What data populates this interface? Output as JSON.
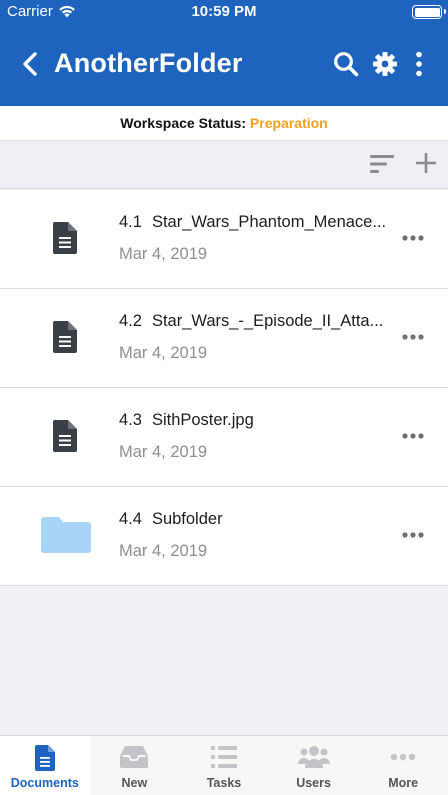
{
  "status_bar": {
    "carrier": "Carrier",
    "time": "10:59 PM"
  },
  "nav": {
    "title": "AnotherFolder",
    "icons": [
      "back-chevron-icon",
      "search-icon",
      "gear-icon",
      "more-vertical-icon"
    ]
  },
  "workspace": {
    "label": "Workspace Status:",
    "value": "Preparation",
    "value_color": "#f0a01e"
  },
  "toolbar": {
    "icons": [
      "sort-icon",
      "add-icon"
    ]
  },
  "items": [
    {
      "number": "4.1",
      "name": "Star_Wars_Phantom_Menace...",
      "date": "Mar 4, 2019",
      "kind": "document"
    },
    {
      "number": "4.2",
      "name": "Star_Wars_-_Episode_II_Atta...",
      "date": "Mar 4, 2019",
      "kind": "document"
    },
    {
      "number": "4.3",
      "name": "SithPoster.jpg",
      "date": "Mar 4, 2019",
      "kind": "document"
    },
    {
      "number": "4.4",
      "name": "Subfolder",
      "date": "Mar 4, 2019",
      "kind": "folder"
    }
  ],
  "tabs": [
    {
      "label": "Documents",
      "icon": "document-icon",
      "active": true
    },
    {
      "label": "New",
      "icon": "inbox-icon",
      "active": false
    },
    {
      "label": "Tasks",
      "icon": "list-icon",
      "active": false
    },
    {
      "label": "Users",
      "icon": "users-icon",
      "active": false
    },
    {
      "label": "More",
      "icon": "more-horizontal-icon",
      "active": false
    }
  ],
  "colors": {
    "brand": "#1e64be",
    "folder": "#a8d4f8",
    "doc_icon": "#3a3f47"
  }
}
